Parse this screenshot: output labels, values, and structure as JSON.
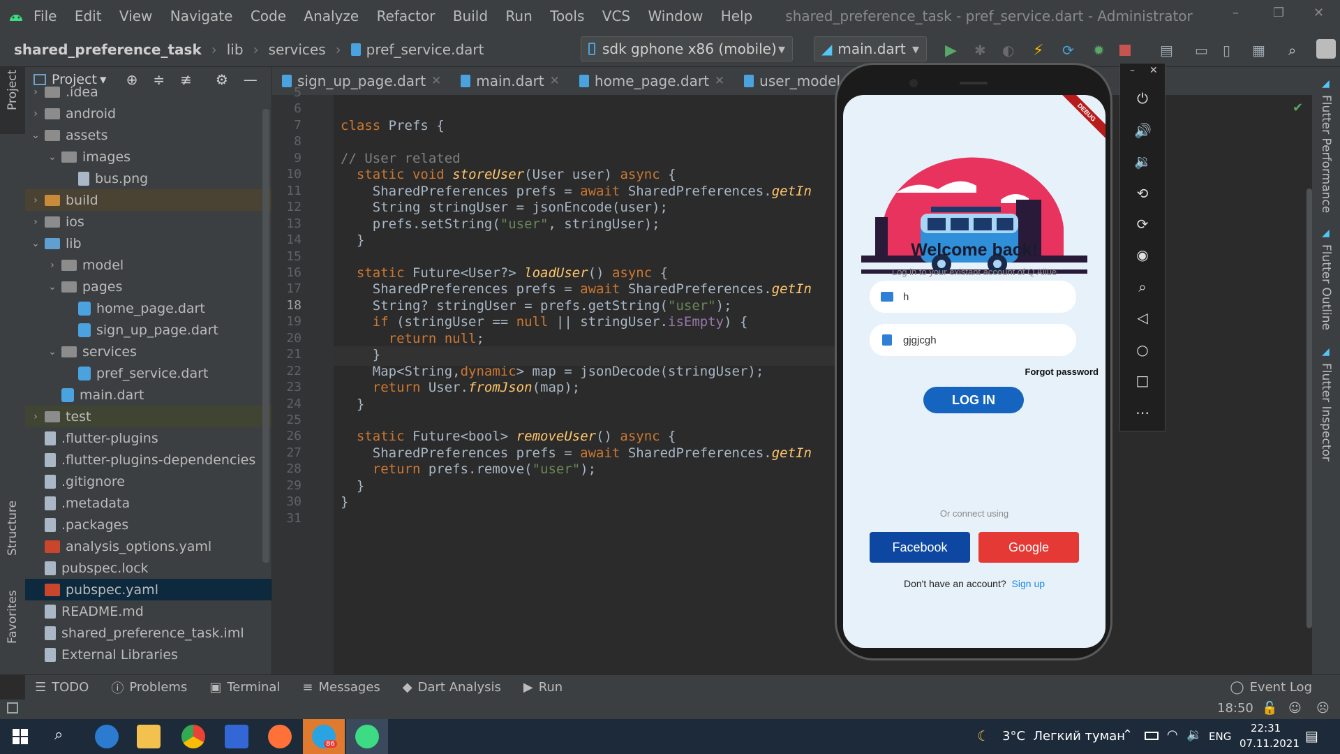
{
  "titlebar": {
    "menu": [
      "File",
      "Edit",
      "View",
      "Navigate",
      "Code",
      "Analyze",
      "Refactor",
      "Build",
      "Run",
      "Tools",
      "VCS",
      "Window",
      "Help"
    ],
    "window_title": "shared_preference_task - pref_service.dart - Administrator",
    "controls": {
      "minimize": "–",
      "restore": "❐",
      "close": "✕"
    }
  },
  "navbar": {
    "breadcrumb": [
      "shared_preference_task",
      "lib",
      "services",
      "pref_service.dart"
    ],
    "device": "sdk gphone x86 (mobile)",
    "run_config": "main.dart"
  },
  "project_panel": {
    "title": "Project",
    "tree": [
      {
        "label": ".idea",
        "arrow": "›",
        "icon": "folder"
      },
      {
        "label": "android",
        "arrow": "›",
        "icon": "folder"
      },
      {
        "label": "assets",
        "arrow": "⌄",
        "icon": "folder"
      },
      {
        "label": "images",
        "arrow": "⌄",
        "icon": "folder"
      },
      {
        "label": "bus.png",
        "arrow": "",
        "icon": "image"
      },
      {
        "label": "build",
        "arrow": "›",
        "icon": "folder-orange"
      },
      {
        "label": "ios",
        "arrow": "›",
        "icon": "folder"
      },
      {
        "label": "lib",
        "arrow": "⌄",
        "icon": "folder-blue"
      },
      {
        "label": "model",
        "arrow": "›",
        "icon": "folder"
      },
      {
        "label": "pages",
        "arrow": "⌄",
        "icon": "folder"
      },
      {
        "label": "home_page.dart",
        "arrow": "",
        "icon": "dart"
      },
      {
        "label": "sign_up_page.dart",
        "arrow": "",
        "icon": "dart"
      },
      {
        "label": "services",
        "arrow": "⌄",
        "icon": "folder"
      },
      {
        "label": "pref_service.dart",
        "arrow": "",
        "icon": "dart"
      },
      {
        "label": "main.dart",
        "arrow": "",
        "icon": "dart"
      },
      {
        "label": "test",
        "arrow": "›",
        "icon": "folder"
      },
      {
        "label": ".flutter-plugins",
        "arrow": "",
        "icon": "file"
      },
      {
        "label": ".flutter-plugins-dependencies",
        "arrow": "",
        "icon": "file"
      },
      {
        "label": ".gitignore",
        "arrow": "",
        "icon": "file"
      },
      {
        "label": ".metadata",
        "arrow": "",
        "icon": "file"
      },
      {
        "label": ".packages",
        "arrow": "",
        "icon": "file"
      },
      {
        "label": "analysis_options.yaml",
        "arrow": "",
        "icon": "yaml"
      },
      {
        "label": "pubspec.lock",
        "arrow": "",
        "icon": "file"
      },
      {
        "label": "pubspec.yaml",
        "arrow": "",
        "icon": "yaml"
      },
      {
        "label": "README.md",
        "arrow": "",
        "icon": "file"
      },
      {
        "label": "shared_preference_task.iml",
        "arrow": "",
        "icon": "file"
      },
      {
        "label": "External Libraries",
        "arrow": "",
        "icon": "library"
      }
    ]
  },
  "tabs": [
    "sign_up_page.dart",
    "main.dart",
    "home_page.dart",
    "user_model.dart"
  ],
  "editor": {
    "line_numbers": [
      "5",
      "6",
      "7",
      "8",
      "9",
      "10",
      "11",
      "12",
      "13",
      "14",
      "15",
      "16",
      "17",
      "18",
      "19",
      "20",
      "21",
      "22",
      "23",
      "24",
      "25",
      "26",
      "27",
      "28",
      "29",
      "30",
      "31"
    ],
    "lines": [
      "",
      "",
      "class Prefs {",
      "",
      "// User related",
      "  static void storeUser(User user) async {",
      "    SharedPreferences prefs = await SharedPreferences.getIn",
      "    String stringUser = jsonEncode(user);",
      "    prefs.setString(\"user\", stringUser);",
      "  }",
      "",
      "  static Future<User?> loadUser() async {",
      "    SharedPreferences prefs = await SharedPreferences.getIn",
      "    String? stringUser = prefs.getString(\"user\");",
      "    if (stringUser == null || stringUser.isEmpty) {",
      "      return null;",
      "    }",
      "    Map<String,dynamic> map = jsonDecode(stringUser);",
      "    return User.fromJson(map);",
      "  }",
      "",
      "  static Future<bool> removeUser() async {",
      "    SharedPreferences prefs = await SharedPreferences.getIn",
      "    return prefs.remove(\"user\");",
      "  }",
      "}",
      ""
    ]
  },
  "phone_app": {
    "debug_banner": "DEBUG",
    "title": "Welcome back!",
    "subtitle": "Log in to your existant account of Q Allue",
    "email_value": "h",
    "password_value": "gjgjcgh",
    "forgot": "Forgot password",
    "login": "LOG IN",
    "or_connect": "Or connect using",
    "facebook": "Facebook",
    "google": "Google",
    "no_account": "Don't have an account?",
    "signup": "Sign up"
  },
  "right_stripe": [
    "Flutter Performance",
    "Flutter Outline",
    "Flutter Inspector"
  ],
  "left_stripe": [
    "Project",
    "Structure",
    "Favorites"
  ],
  "bottom_tools": [
    "TODO",
    "Problems",
    "Terminal",
    "Messages",
    "Dart Analysis",
    "Run"
  ],
  "event_log": "Event Log",
  "status": {
    "position": "18:50"
  },
  "taskbar": {
    "weather": "3°C  Легкий туман",
    "lang": "ENG",
    "time": "22:31",
    "date": "07.11.2021",
    "telegram_badge": "86"
  },
  "colors": {
    "ide_bg": "#2b2b2b",
    "panel_bg": "#3c3f41",
    "keyword": "#cc7832",
    "string": "#6a8759",
    "login_blue": "#1565c0",
    "facebook_blue": "#0d47a1",
    "google_red": "#e53935"
  }
}
